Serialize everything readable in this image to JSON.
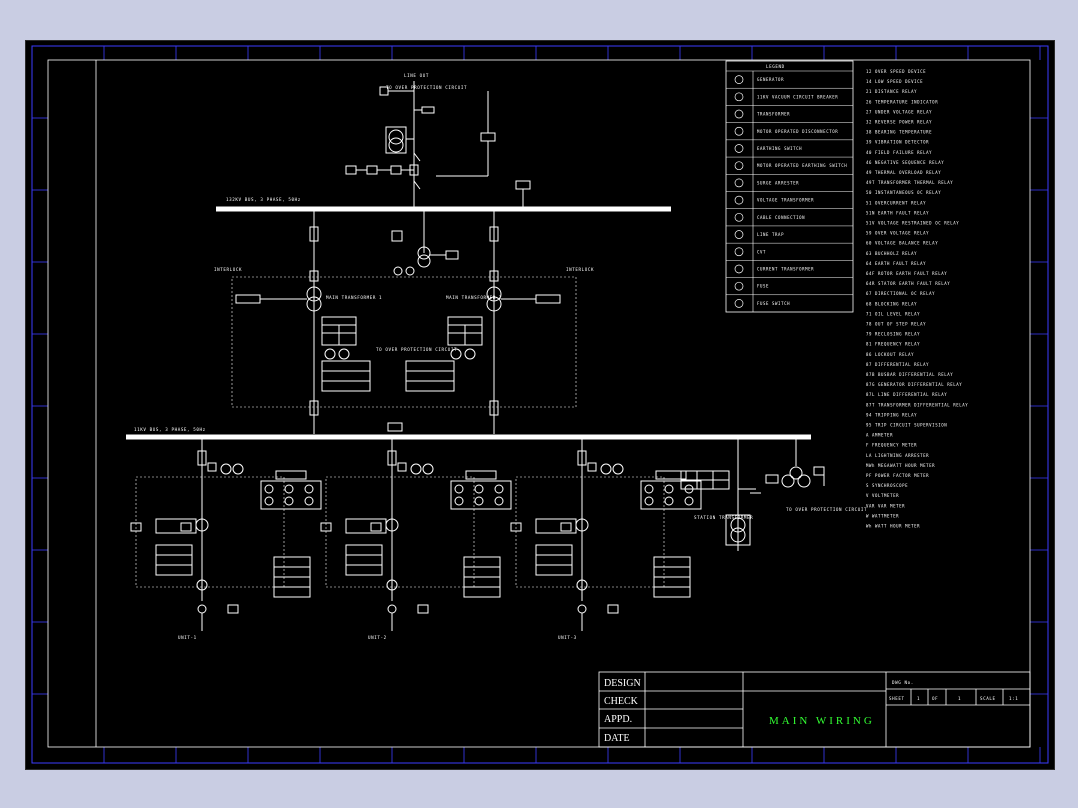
{
  "colors": {
    "background": "#c9cde3",
    "drawing": "#000000",
    "frame": "#3b3bff",
    "line": "#ffffff",
    "title_text": "#33ff33",
    "legend_line": "#ffffff"
  },
  "title_block": {
    "design": "DESIGN",
    "check": "CHECK",
    "appd": "APPD.",
    "date": "DATE",
    "title": "MAIN WIRING",
    "dwg_no": "DWG No.",
    "sheet_label": "SHEET",
    "sheet_no": "1",
    "of_label": "OF",
    "of_no": "1",
    "scale_label": "SCALE",
    "scale_value": "1:1"
  },
  "legend": {
    "title": "LEGEND",
    "items": [
      "GENERATOR",
      "11KV VACUUM CIRCUIT BREAKER",
      "TRANSFORMER",
      "MOTOR OPERATED DISCONNECTOR",
      "EARTHING SWITCH",
      "MOTOR OPERATED EARTHING SWITCH",
      "SURGE ARRESTER",
      "VOLTAGE TRANSFORMER",
      "CABLE CONNECTION",
      "LINE TRAP",
      "CVT",
      "CURRENT TRANSFORMER",
      "FUSE",
      "FUSE SWITCH"
    ],
    "codes": [
      "12  OVER SPEED DEVICE",
      "14  LOW SPEED DEVICE",
      "21  DISTANCE RELAY",
      "26  TEMPERATURE INDICATOR",
      "27  UNDER VOLTAGE RELAY",
      "32  REVERSE POWER RELAY",
      "38  BEARING TEMPERATURE",
      "39  VIBRATION DETECTOR",
      "40  FIELD FAILURE RELAY",
      "46  NEGATIVE SEQUENCE RELAY",
      "49  THERMAL OVERLOAD RELAY",
      "49T TRANSFORMER THERMAL RELAY",
      "50  INSTANTANEOUS OC RELAY",
      "51  OVERCURRENT RELAY",
      "51N EARTH FAULT RELAY",
      "51V VOLTAGE RESTRAINED OC RELAY",
      "59  OVER VOLTAGE RELAY",
      "60  VOLTAGE BALANCE RELAY",
      "63  BUCHHOLZ RELAY",
      "64  EARTH FAULT RELAY",
      "64F ROTOR EARTH FAULT RELAY",
      "64R STATOR EARTH FAULT RELAY",
      "67  DIRECTIONAL OC RELAY",
      "68  BLOCKING RELAY",
      "71  OIL LEVEL RELAY",
      "78  OUT OF STEP RELAY",
      "79  RECLOSING RELAY",
      "81  FREQUENCY RELAY",
      "86  LOCKOUT RELAY",
      "87  DIFFERENTIAL RELAY",
      "87B BUSBAR DIFFERENTIAL RELAY",
      "87G GENERATOR DIFFERENTIAL RELAY",
      "87L LINE DIFFERENTIAL RELAY",
      "87T TRANSFORMER DIFFERENTIAL RELAY",
      "94  TRIPPING RELAY",
      "95  TRIP CIRCUIT SUPERVISION",
      "A   AMMETER",
      "F   FREQUENCY METER",
      "LA  LIGHTNING ARRESTER",
      "MWh MEGAWATT HOUR METER",
      "PF  POWER FACTOR METER",
      "S   SYNCHROSCOPE",
      "V   VOLTMETER",
      "VAR VAR METER",
      "W   WATTMETER",
      "Wh  WATT HOUR METER"
    ]
  },
  "diagram": {
    "top_line": "LINE OUT",
    "bus_hv": "132KV BUS, 3 PHASE, 50Hz",
    "bus_lv": "11KV BUS, 3 PHASE, 50Hz",
    "interlock": "INTERLOCK",
    "main_tx_left": "MAIN TRANSFORMER 1",
    "main_tx_right": "MAIN TRANSFORMER 2",
    "to_protection": "TO OVER PROTECTION CIRCUIT",
    "station_tx": "STATION TRANSFORMER",
    "gen_label": "GENERATOR",
    "unit_labels": [
      "UNIT-1",
      "UNIT-2",
      "UNIT-3"
    ]
  }
}
